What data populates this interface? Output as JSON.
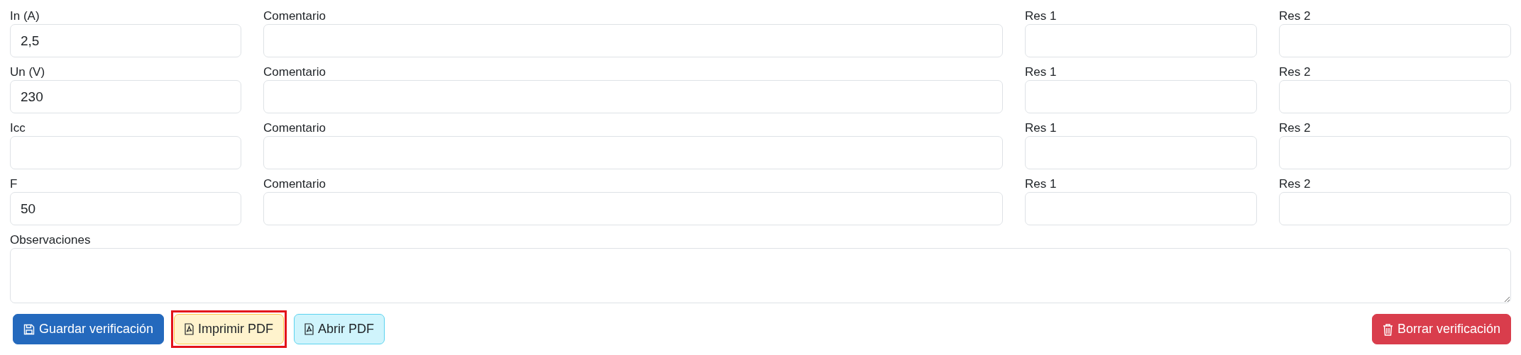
{
  "rows": [
    {
      "label": "In (A)",
      "value": "2,5",
      "comment_label": "Comentario",
      "res1_label": "Res 1",
      "res2_label": "Res 2"
    },
    {
      "label": "Un (V)",
      "value": "230",
      "comment_label": "Comentario",
      "res1_label": "Res 1",
      "res2_label": "Res 2"
    },
    {
      "label": "Icc",
      "comment_label": "Comentario",
      "res1_label": "Res 1",
      "res2_label": "Res 2"
    },
    {
      "label": "F",
      "value": "50",
      "comment_label": "Comentario",
      "res1_label": "Res 1",
      "res2_label": "Res 2"
    }
  ],
  "observations": {
    "label": "Observaciones"
  },
  "buttons": [
    {
      "label": "Guardar verificación",
      "kind": "primary",
      "highlighted": false
    },
    {
      "label": "Imprimir PDF",
      "kind": "warning",
      "highlighted": true
    },
    {
      "label": "Abrir PDF",
      "kind": "info",
      "highlighted": false
    }
  ],
  "delete_button": {
    "label": "Borrar verificación",
    "kind": "danger"
  }
}
